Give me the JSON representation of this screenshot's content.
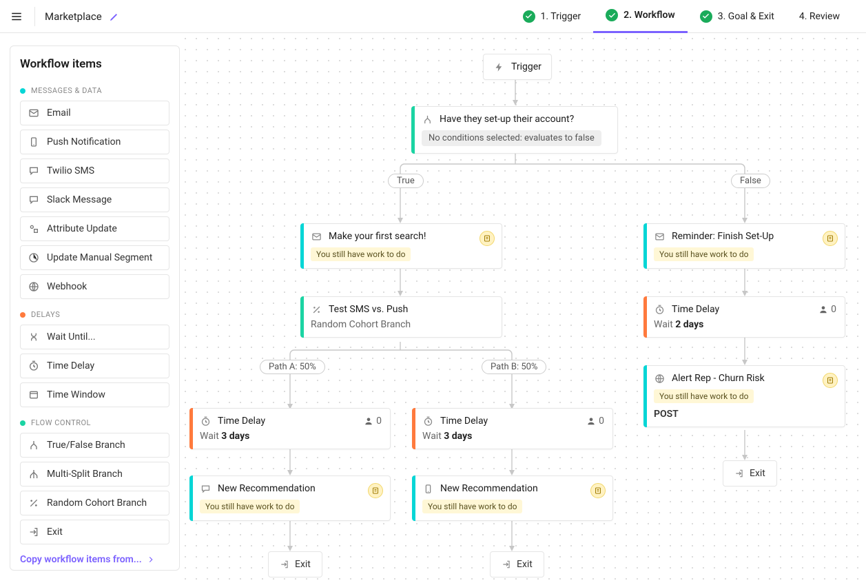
{
  "header": {
    "title": "Marketplace",
    "steps": [
      {
        "label": "1. Trigger",
        "checked": true,
        "active": false
      },
      {
        "label": "2. Workflow",
        "checked": true,
        "active": true
      },
      {
        "label": "3. Goal & Exit",
        "checked": true,
        "active": false
      },
      {
        "label": "4. Review",
        "checked": false,
        "active": false
      }
    ]
  },
  "sidebar": {
    "heading": "Workflow items",
    "groups": [
      {
        "name": "MESSAGES & DATA",
        "color": "cyan",
        "items": [
          {
            "label": "Email",
            "icon": "mail"
          },
          {
            "label": "Push Notification",
            "icon": "phone"
          },
          {
            "label": "Twilio SMS",
            "icon": "sms"
          },
          {
            "label": "Slack Message",
            "icon": "sms"
          },
          {
            "label": "Attribute Update",
            "icon": "attr"
          },
          {
            "label": "Update Manual Segment",
            "icon": "segment"
          },
          {
            "label": "Webhook",
            "icon": "globe"
          }
        ]
      },
      {
        "name": "DELAYS",
        "color": "orange",
        "items": [
          {
            "label": "Wait Until...",
            "icon": "wait"
          },
          {
            "label": "Time Delay",
            "icon": "timer"
          },
          {
            "label": "Time Window",
            "icon": "window"
          }
        ]
      },
      {
        "name": "FLOW CONTROL",
        "color": "green",
        "items": [
          {
            "label": "True/False Branch",
            "icon": "split"
          },
          {
            "label": "Multi-Split Branch",
            "icon": "multisplit"
          },
          {
            "label": "Random Cohort Branch",
            "icon": "random"
          },
          {
            "label": "Exit",
            "icon": "exit"
          }
        ]
      }
    ],
    "copy_link": "Copy workflow items from..."
  },
  "canvas": {
    "trigger_label": "Trigger",
    "condition": {
      "title": "Have they set-up their account?",
      "sub": "No conditions selected: evaluates to false",
      "true_label": "True",
      "false_label": "False"
    },
    "email_true": {
      "title": "Make your first search!",
      "tag": "You still have work to do"
    },
    "email_false": {
      "title": "Reminder: Finish Set-Up",
      "tag": "You still have work to do"
    },
    "split": {
      "title": "Test SMS vs. Push",
      "sub": "Random Cohort Branch",
      "path_a": "Path A: 50%",
      "path_b": "Path B: 50%"
    },
    "delay_false": {
      "title": "Time Delay",
      "wait_prefix": "Wait ",
      "wait_value": "2 days",
      "count": "0"
    },
    "webhook": {
      "title": "Alert Rep - Churn Risk",
      "tag": "You still have work to do",
      "method": "POST"
    },
    "delay_a": {
      "title": "Time Delay",
      "wait_prefix": "Wait ",
      "wait_value": "3 days",
      "count": "0"
    },
    "delay_b": {
      "title": "Time Delay",
      "wait_prefix": "Wait ",
      "wait_value": "3 days",
      "count": "0"
    },
    "rec_a": {
      "title": "New Recommendation",
      "tag": "You still have work to do"
    },
    "rec_b": {
      "title": "New Recommendation",
      "tag": "You still have work to do"
    },
    "exit_label": "Exit"
  }
}
